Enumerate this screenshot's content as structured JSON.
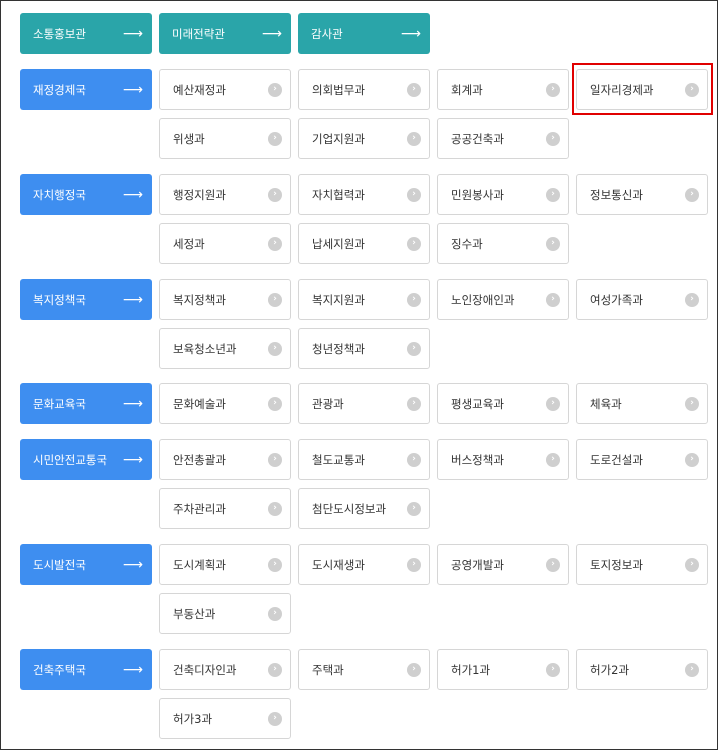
{
  "top_nav": [
    {
      "label": "소통홍보관"
    },
    {
      "label": "미래전략관"
    },
    {
      "label": "감사관"
    }
  ],
  "arrow_glyph": "⟶",
  "chevron_glyph": "›",
  "highlight_color": "#e00000",
  "colors": {
    "teal": "#2aa5a9",
    "blue": "#3e8ef0"
  },
  "bureaus": [
    {
      "label": "재정경제국",
      "items": [
        "예산재정과",
        "의회법무과",
        "회계과",
        "일자리경제과",
        "위생과",
        "기업지원과",
        "공공건축과"
      ]
    },
    {
      "label": "자치행정국",
      "items": [
        "행정지원과",
        "자치협력과",
        "민원봉사과",
        "정보통신과",
        "세정과",
        "납세지원과",
        "징수과"
      ]
    },
    {
      "label": "복지정책국",
      "items": [
        "복지정책과",
        "복지지원과",
        "노인장애인과",
        "여성가족과",
        "보육청소년과",
        "청년정책과"
      ]
    },
    {
      "label": "문화교육국",
      "items": [
        "문화예술과",
        "관광과",
        "평생교육과",
        "체육과"
      ]
    },
    {
      "label": "시민안전교통국",
      "items": [
        "안전총괄과",
        "철도교통과",
        "버스정책과",
        "도로건설과",
        "주차관리과",
        "첨단도시정보과"
      ]
    },
    {
      "label": "도시발전국",
      "items": [
        "도시계획과",
        "도시재생과",
        "공영개발과",
        "토지정보과",
        "부동산과"
      ]
    },
    {
      "label": "건축주택국",
      "items": [
        "건축디자인과",
        "주택과",
        "허가1과",
        "허가2과",
        "허가3과"
      ]
    }
  ]
}
